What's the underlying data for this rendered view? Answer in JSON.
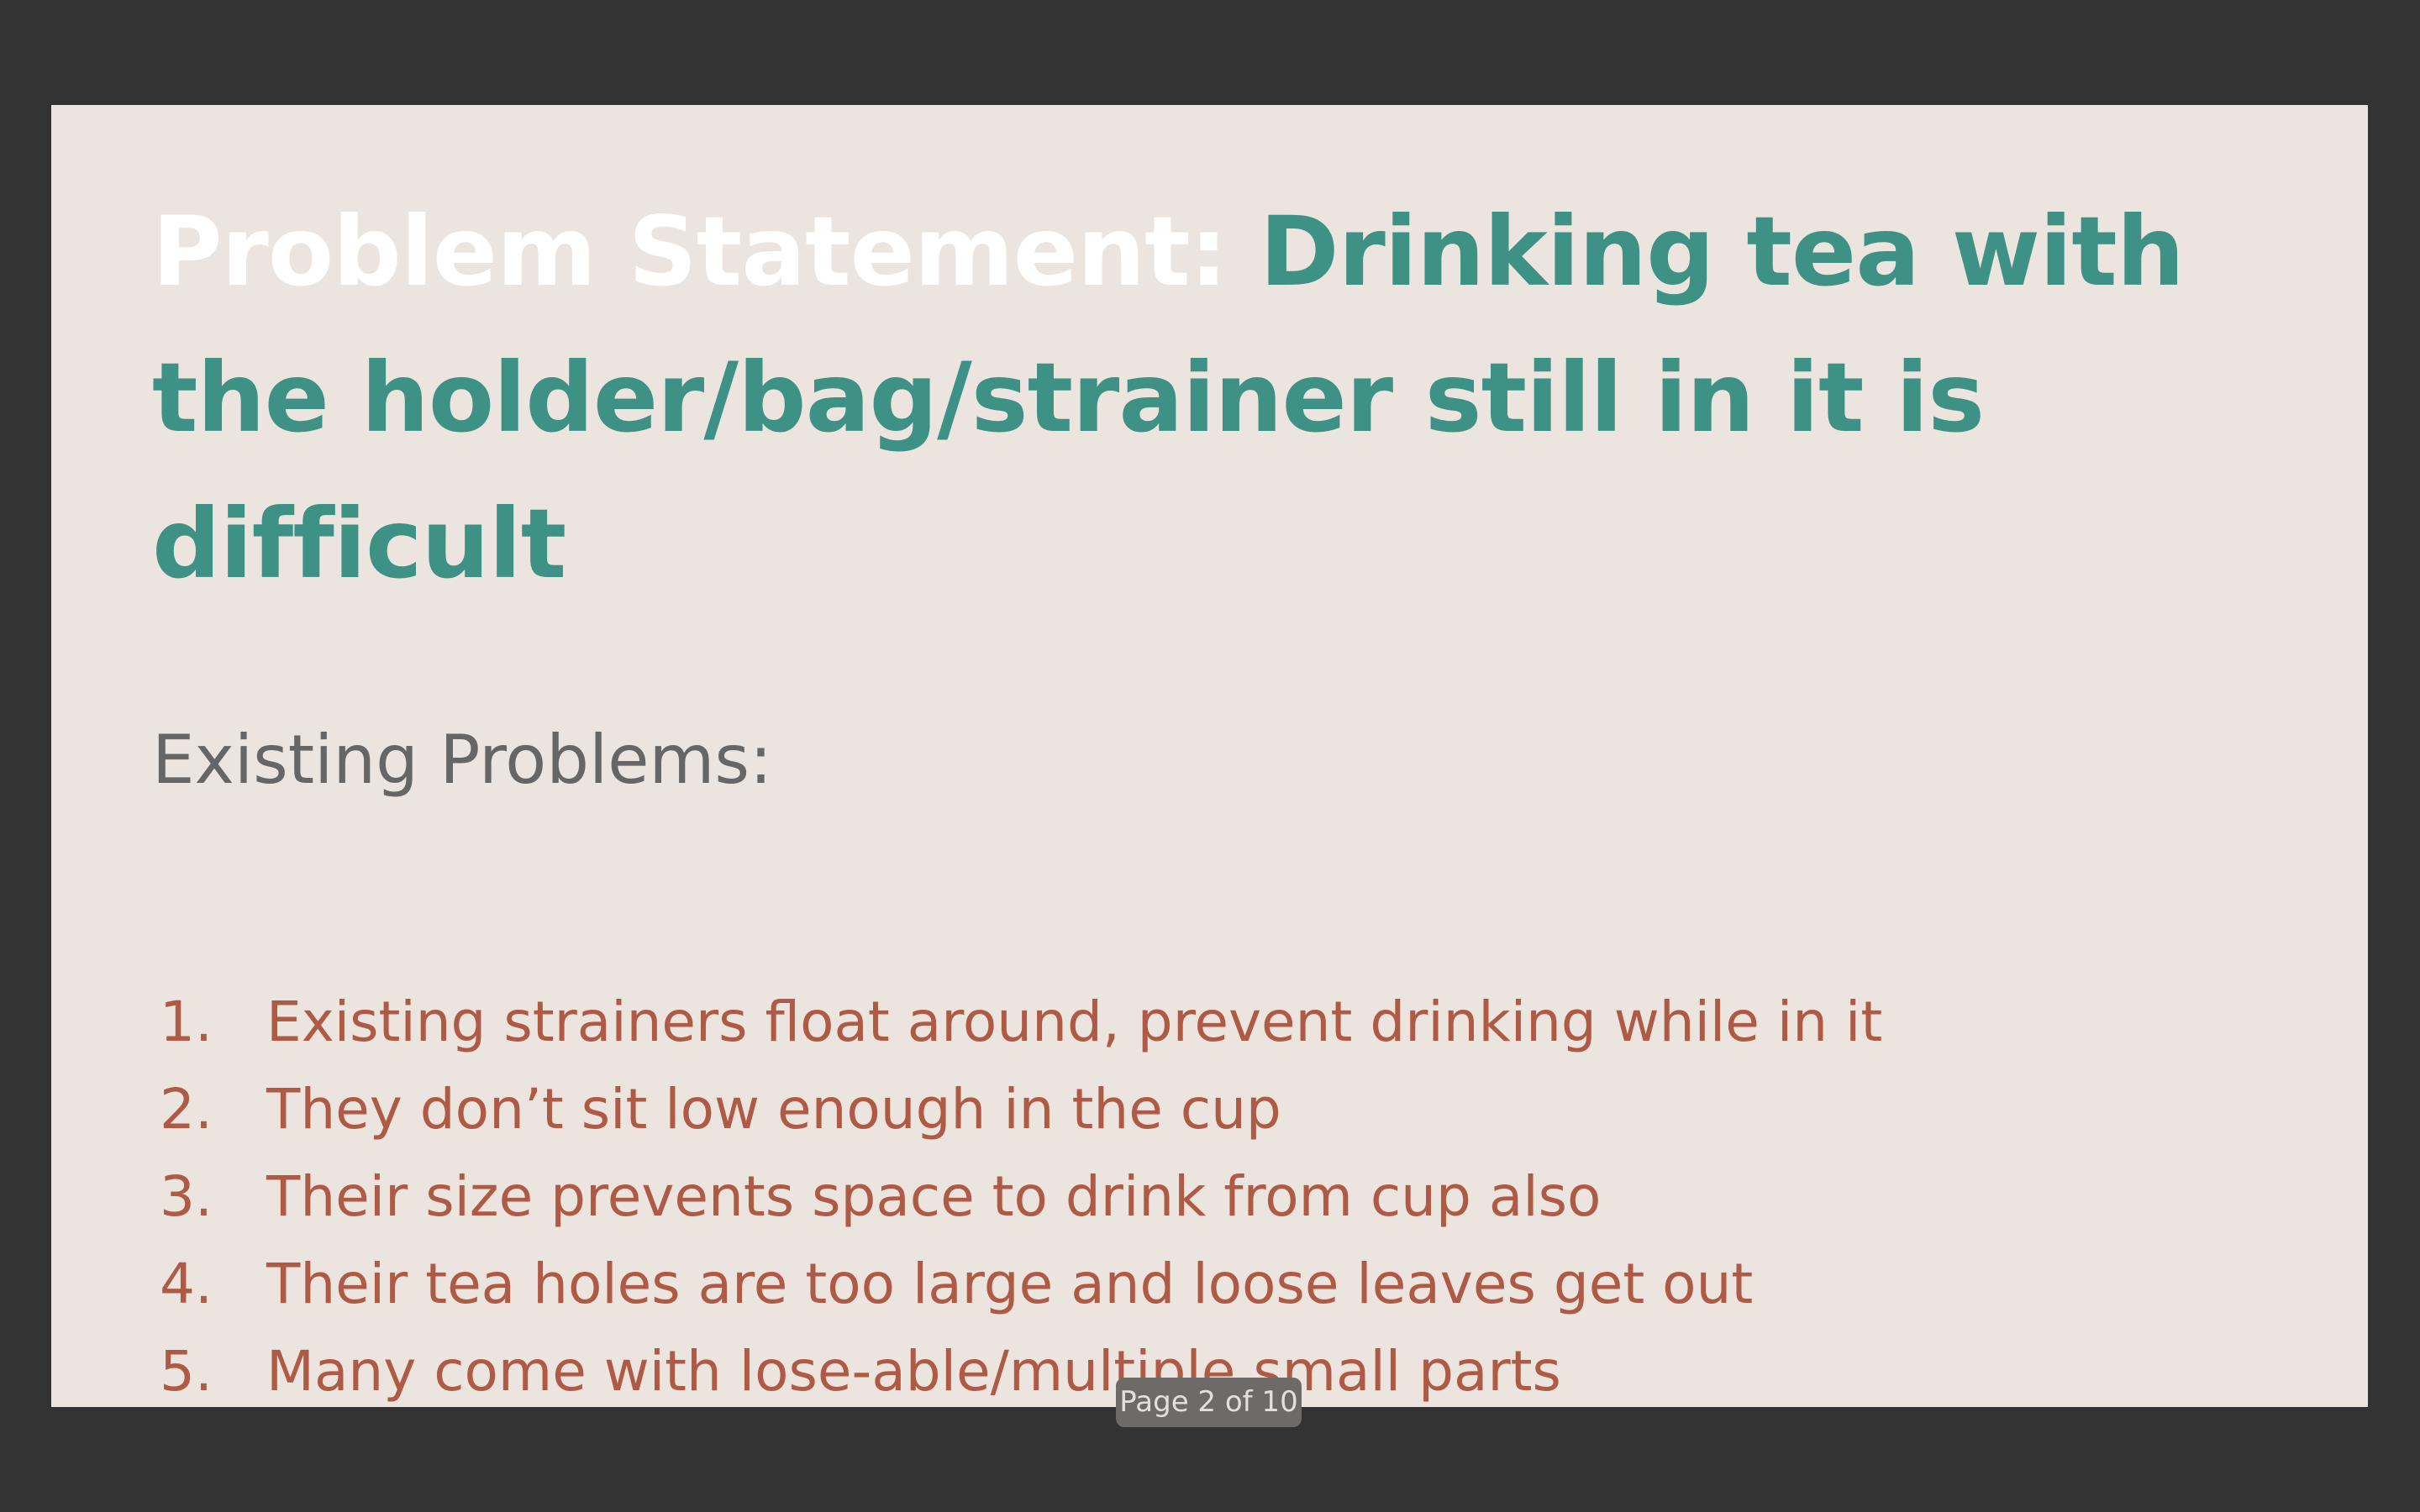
{
  "slide": {
    "title_lead": "Problem Statement: ",
    "title_rest": "Drinking tea with the holder/bag/strainer still in it is difficult",
    "subheading": "Existing Problems:",
    "problems": [
      {
        "number": "1.",
        "text": "Existing strainers float around, prevent drinking while in it"
      },
      {
        "number": "2.",
        "text": "They don’t sit low enough in the cup"
      },
      {
        "number": "3.",
        "text": "Their size prevents space to drink from cup also"
      },
      {
        "number": "4.",
        "text": "Their tea holes are too large and loose leaves get out"
      },
      {
        "number": "5.",
        "text": "Many come with lose-able/multiple small parts"
      }
    ]
  },
  "viewer": {
    "page_indicator": "Page 2 of 10"
  },
  "colors": {
    "viewer_background": "#333333",
    "slide_background": "#ece4de",
    "title_lead": "#ffffff",
    "title_accent": "#3e9185",
    "subheading": "#666666",
    "list_text": "#ae5a45"
  }
}
